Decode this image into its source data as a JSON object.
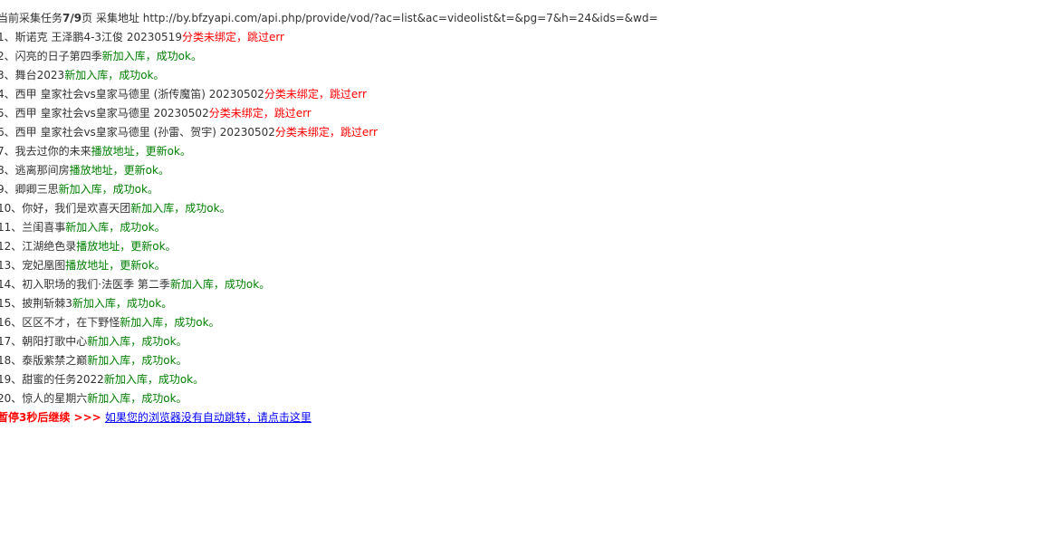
{
  "header": {
    "prefix": "当前采集任务",
    "current_page": "7",
    "slash": "/",
    "total_pages": "9",
    "page_suffix": "页",
    "address_label": " 采集地址 ",
    "api_url": "http://by.bfzyapi.com/api.php/provide/vod/?ac=list&ac=videolist&t=&pg=7&h=24&ids=&wd="
  },
  "items": [
    {
      "index": "1、",
      "title": "斯诺克 王泽鹏4-3江俊 20230519",
      "status": "分类未绑定，跳过err",
      "kind": "err"
    },
    {
      "index": "2、",
      "title": "闪亮的日子第四季",
      "status": "新加入库，成功ok。",
      "kind": "ok"
    },
    {
      "index": "3、",
      "title": "舞台2023",
      "status": "新加入库，成功ok。",
      "kind": "ok"
    },
    {
      "index": "4、",
      "title": "西甲 皇家社会vs皇家马德里 (浙传魔笛) 20230502",
      "status": "分类未绑定，跳过err",
      "kind": "err"
    },
    {
      "index": "5、",
      "title": "西甲 皇家社会vs皇家马德里 20230502",
      "status": "分类未绑定，跳过err",
      "kind": "err"
    },
    {
      "index": "6、",
      "title": "西甲 皇家社会vs皇家马德里 (孙雷、贺宇) 20230502",
      "status": "分类未绑定，跳过err",
      "kind": "err"
    },
    {
      "index": "7、",
      "title": "我去过你的未来",
      "status": "播放地址，更新ok。",
      "kind": "ok"
    },
    {
      "index": "8、",
      "title": "逃离那间房",
      "status": "播放地址，更新ok。",
      "kind": "ok"
    },
    {
      "index": "9、",
      "title": "卿卿三思",
      "status": "新加入库，成功ok。",
      "kind": "ok"
    },
    {
      "index": "10、",
      "title": "你好，我们是欢喜天团",
      "status": "新加入库，成功ok。",
      "kind": "ok"
    },
    {
      "index": "11、",
      "title": "兰闺喜事",
      "status": "新加入库，成功ok。",
      "kind": "ok"
    },
    {
      "index": "12、",
      "title": "江湖绝色录",
      "status": "播放地址，更新ok。",
      "kind": "ok"
    },
    {
      "index": "13、",
      "title": "宠妃凰图",
      "status": "播放地址，更新ok。",
      "kind": "ok"
    },
    {
      "index": "14、",
      "title": "初入职场的我们·法医季 第二季",
      "status": "新加入库，成功ok。",
      "kind": "ok"
    },
    {
      "index": "15、",
      "title": "披荆斩棘3",
      "status": "新加入库，成功ok。",
      "kind": "ok"
    },
    {
      "index": "16、",
      "title": "区区不才，在下野怪",
      "status": "新加入库，成功ok。",
      "kind": "ok"
    },
    {
      "index": "17、",
      "title": "朝阳打歌中心",
      "status": "新加入库，成功ok。",
      "kind": "ok"
    },
    {
      "index": "18、",
      "title": "泰版紫禁之巅",
      "status": "新加入库，成功ok。",
      "kind": "ok"
    },
    {
      "index": "19、",
      "title": "甜蜜的任务2022",
      "status": "新加入库，成功ok。",
      "kind": "ok"
    },
    {
      "index": "20、",
      "title": "惊人的星期六",
      "status": "新加入库，成功ok。",
      "kind": "ok"
    }
  ],
  "footer": {
    "pause_text": "暂停3秒后继续",
    "arrows": " >>> ",
    "redirect_link": "如果您的浏览器没有自动跳转，请点击这里"
  },
  "colors": {
    "ok": "#008000",
    "err": "#ff0000",
    "link": "#0000ff",
    "text": "#333333"
  }
}
